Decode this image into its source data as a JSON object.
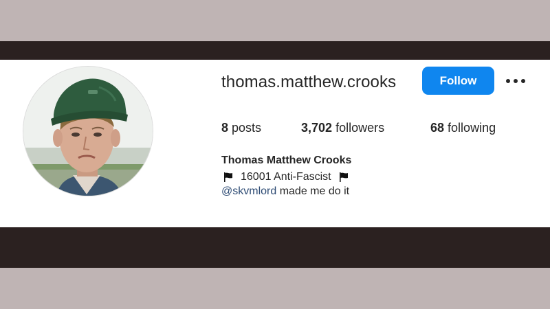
{
  "colors": {
    "background": "#bfb4b4",
    "frame_band": "#2b2120",
    "panel": "#ffffff",
    "follow_button": "#0f86ef",
    "text": "#262626",
    "mention": "#2d4b74"
  },
  "profile": {
    "username": "thomas.matthew.crooks",
    "follow_label": "Follow",
    "more_icon": "more-options-icon",
    "avatar_icon": "profile-photo",
    "stats": {
      "posts_count": "8",
      "posts_label": "posts",
      "followers_count": "3,702",
      "followers_label": "followers",
      "following_count": "68",
      "following_label": "following"
    },
    "full_name": "Thomas Matthew Crooks",
    "bio": {
      "line1_text": "16001 Anti-Fascist",
      "line1_icon": "black-flag-icon",
      "mention": "@skvmlord",
      "line2_rest": "made me do it"
    }
  }
}
